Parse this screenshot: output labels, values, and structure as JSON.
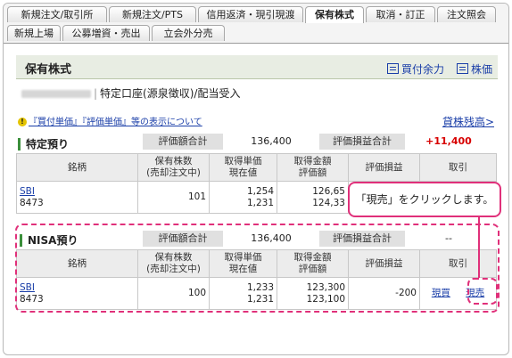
{
  "tabs_row1": [
    "新規注文/取引所",
    "新規注文/PTS",
    "信用返済・現引現渡",
    "保有株式",
    "取消・訂正",
    "注文照会"
  ],
  "tabs_row2": [
    "新規上場",
    "公募増資・売出",
    "立会外分売"
  ],
  "active_tab": "保有株式",
  "section": {
    "title": "保有株式",
    "link_buying_power": "買付余力",
    "link_stock_price": "株価"
  },
  "account": {
    "type": "特定口座(源泉徴収)/配当受入"
  },
  "info": {
    "icon": "!",
    "link": "『買付単価』『評価単価』等の表示について",
    "balance_link": "貸株残高>"
  },
  "summary_labels": {
    "valuation_total": "評価額合計",
    "pl_total": "評価損益合計"
  },
  "columns": {
    "name": "銘柄",
    "qty": "保有株数\n(売却注文中)",
    "price": "取得単価\n現在値",
    "amount": "取得金額\n評価額",
    "pl": "評価損益",
    "trade": "取引"
  },
  "tokutei": {
    "label": "特定預り",
    "valuation_total": "136,400",
    "pl_total": "+11,400",
    "row": {
      "name": "SBI",
      "code": "8473",
      "qty": "101",
      "cost_unit": "1,254",
      "current": "1,231",
      "cost_total": "126,65",
      "valuation": "124,33"
    }
  },
  "nisa": {
    "label": "NISA預り",
    "valuation_total": "136,400",
    "pl_total": "--",
    "row": {
      "name": "SBI",
      "code": "8473",
      "qty": "100",
      "cost_unit": "1,233",
      "current": "1,231",
      "cost_total": "123,300",
      "valuation": "123,100",
      "pl": "-200",
      "action_buy": "現買",
      "action_sell": "現売"
    }
  },
  "callout": {
    "text": "「現売」をクリックします。"
  },
  "colors": {
    "accent": "#e0307a",
    "link": "#1a3ea8",
    "profit": "#d70000",
    "group_bar": "#3b8f3b"
  }
}
